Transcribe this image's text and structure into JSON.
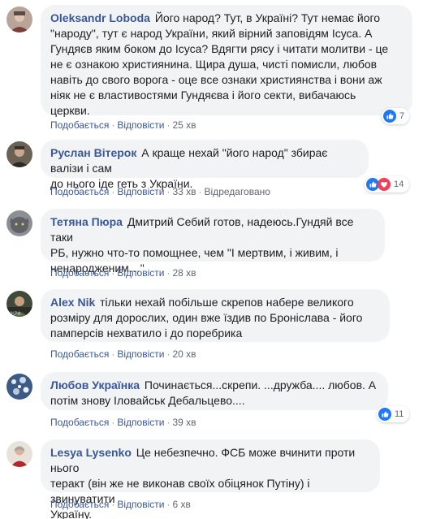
{
  "action_labels": {
    "like": "Подобається",
    "reply": "Відповісти",
    "separator": "·"
  },
  "colors": {
    "bubble": "#f2f3f5",
    "author": "#385898",
    "like": "#2078f4",
    "love": "#f33e58"
  },
  "comments": [
    {
      "author": "Oleksandr Loboda",
      "lines": [
        "Його народ? Тут, в Україні? Тут немає його",
        "\"народу\", тут є народ України, який вірний заповідям Ісуса. А",
        "Гундяєв яким боком до Ісуса? Вдягти рясу і читати молитви - це",
        "не є ознакою християнина. Щира душа, чисті помисли, любов",
        "навіть до свого ворога - оце все ознаки християнства і вони аж",
        "ніяк не є властивостями Гундяєва і його секти, вибачаюсь",
        "церкви."
      ],
      "time": "25 хв",
      "edited": "",
      "reactions": {
        "icons": [
          "like-icon"
        ],
        "count": "7"
      }
    },
    {
      "author": "Руслан Вітерок",
      "lines": [
        "А краще нехай \"його народ\" збирає валізи і сам",
        "до нього іде геть з України."
      ],
      "time": "33 хв",
      "edited": "Відредаговано",
      "reactions": {
        "icons": [
          "like-icon",
          "love-icon"
        ],
        "count": "14"
      }
    },
    {
      "author": "Тетяна Пюра",
      "lines": [
        "Дмитрий Себий готов, надеюсь.Гундяй все таки",
        "РБ, нужно что-то помощнее, чем \"І мертвим, і живим, і",
        "ненародженим…\""
      ],
      "time": "28 хв",
      "edited": "",
      "reactions": null
    },
    {
      "author": "Alex Nik",
      "lines": [
        "тільки нехай побільше скрепов набере великого",
        "розміру для дорослих, один вже їздив по Броніслава - його",
        "памперсів нехватило і до поребрика"
      ],
      "time": "20 хв",
      "edited": "",
      "reactions": null
    },
    {
      "author": "Любов Українка",
      "lines": [
        "Починається...скрепи. ...дружба.... любов. А",
        "потім знову Іловайськ Дебальцево...."
      ],
      "time": "39 хв",
      "edited": "",
      "reactions": {
        "icons": [
          "like-icon"
        ],
        "count": "11"
      }
    },
    {
      "author": "Lesya Lysenko",
      "lines": [
        "Це небезпечно. ФСБ може вчинити проти нього",
        "теракт (він же не виконав своїх обіцянок Путіну) і звинуватити",
        "Україну."
      ],
      "time": "6 хв",
      "edited": "",
      "reactions": null
    }
  ]
}
